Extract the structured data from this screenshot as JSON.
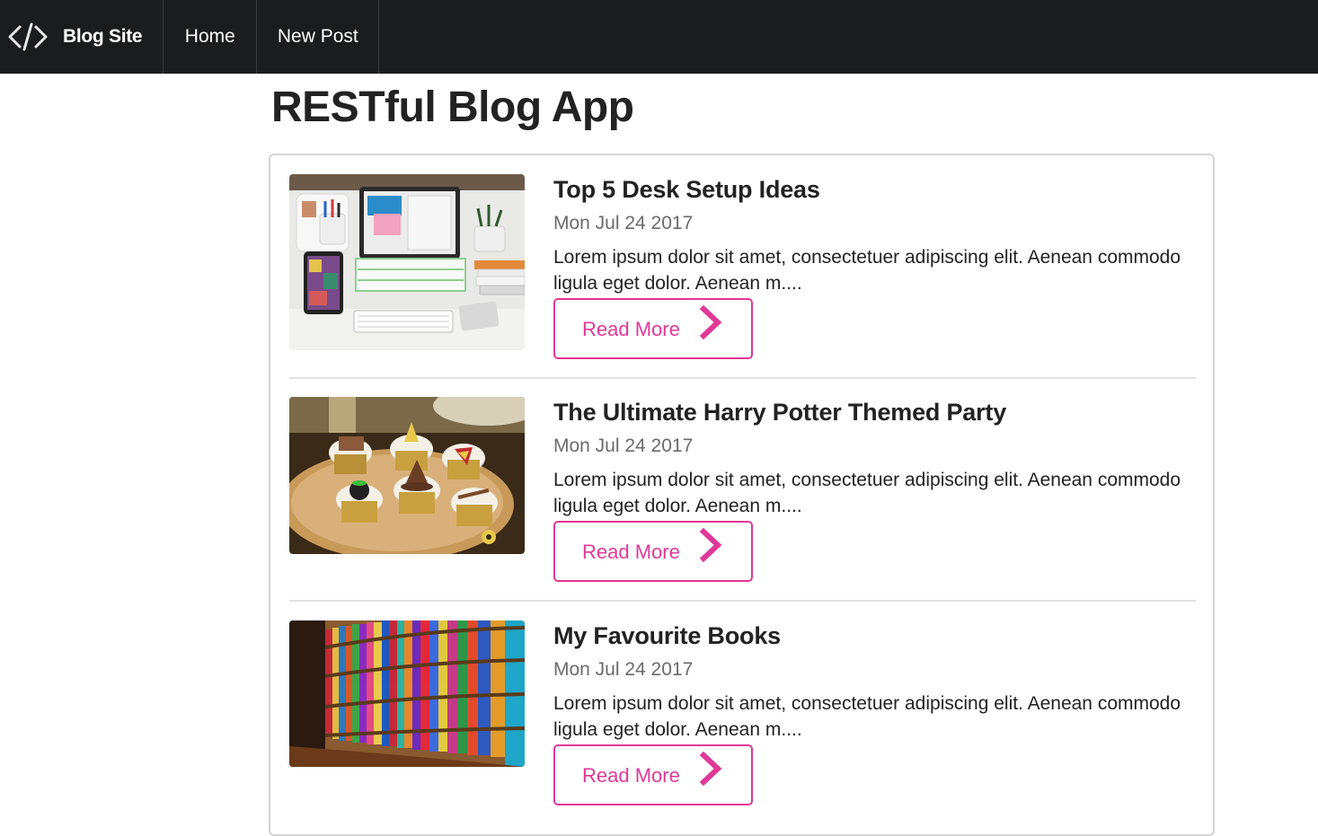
{
  "nav": {
    "brand_label": "Blog Site",
    "brand_icon": "code-icon",
    "home_label": "Home",
    "new_post_label": "New Post"
  },
  "page": {
    "title": "RESTful Blog App"
  },
  "posts": [
    {
      "title": "Top 5 Desk Setup Ideas",
      "date": "Mon Jul 24 2017",
      "excerpt": "Lorem ipsum dolor sit amet, consectetuer adipiscing elit. Aenean commodo ligula eget dolor. Aenean m....",
      "read_more_label": "Read More",
      "image": "desk-setup-photo"
    },
    {
      "title": "The Ultimate Harry Potter Themed Party",
      "date": "Mon Jul 24 2017",
      "excerpt": "Lorem ipsum dolor sit amet, consectetuer adipiscing elit. Aenean commodo ligula eget dolor. Aenean m....",
      "read_more_label": "Read More",
      "image": "themed-cupcakes-photo"
    },
    {
      "title": "My Favourite Books",
      "date": "Mon Jul 24 2017",
      "excerpt": "Lorem ipsum dolor sit amet, consectetuer adipiscing elit. Aenean commodo ligula eget dolor. Aenean m....",
      "read_more_label": "Read More",
      "image": "bookshelf-photo"
    }
  ],
  "colors": {
    "nav_bg": "#1b1c1d",
    "accent_pink": "#e03997",
    "divider": "#e2e2e2"
  }
}
